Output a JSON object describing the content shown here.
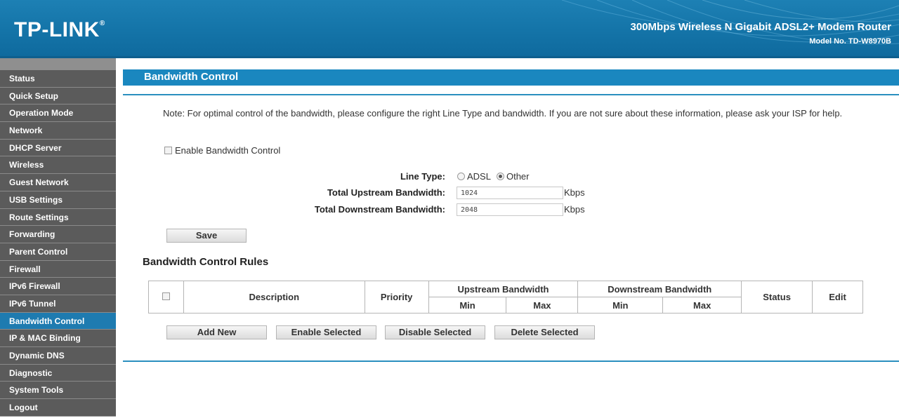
{
  "header": {
    "logo": "TP-LINK",
    "product": "300Mbps Wireless N Gigabit ADSL2+ Modem Router",
    "model": "Model No. TD-W8970B"
  },
  "sidebar": {
    "items": [
      {
        "label": "Status",
        "name": "status"
      },
      {
        "label": "Quick Setup",
        "name": "quick-setup"
      },
      {
        "label": "Operation Mode",
        "name": "operation-mode"
      },
      {
        "label": "Network",
        "name": "network"
      },
      {
        "label": "DHCP Server",
        "name": "dhcp-server"
      },
      {
        "label": "Wireless",
        "name": "wireless"
      },
      {
        "label": "Guest Network",
        "name": "guest-network"
      },
      {
        "label": "USB Settings",
        "name": "usb-settings"
      },
      {
        "label": "Route Settings",
        "name": "route-settings"
      },
      {
        "label": "Forwarding",
        "name": "forwarding"
      },
      {
        "label": "Parent Control",
        "name": "parent-control"
      },
      {
        "label": "Firewall",
        "name": "firewall"
      },
      {
        "label": "IPv6 Firewall",
        "name": "ipv6-firewall"
      },
      {
        "label": "IPv6 Tunnel",
        "name": "ipv6-tunnel"
      },
      {
        "label": "Bandwidth Control",
        "name": "bandwidth-control",
        "active": true
      },
      {
        "label": "IP & MAC Binding",
        "name": "ip-mac-binding"
      },
      {
        "label": "Dynamic DNS",
        "name": "dynamic-dns"
      },
      {
        "label": "Diagnostic",
        "name": "diagnostic"
      },
      {
        "label": "System Tools",
        "name": "system-tools"
      },
      {
        "label": "Logout",
        "name": "logout"
      }
    ]
  },
  "main": {
    "title": "Bandwidth Control",
    "note": "Note: For optimal control of the bandwidth, please configure the right Line Type and bandwidth. If you are not sure about these information, please ask your ISP for help.",
    "enable_label": "Enable Bandwidth Control",
    "line_type_label": "Line Type:",
    "line_type_options": {
      "adsl": "ADSL",
      "other": "Other"
    },
    "line_type_selected": "Other",
    "upstream_label": "Total Upstream Bandwidth:",
    "upstream_value": "1024",
    "downstream_label": "Total Downstream Bandwidth:",
    "downstream_value": "2048",
    "unit": "Kbps",
    "save_label": "Save",
    "rules_title": "Bandwidth Control Rules",
    "table": {
      "description": "Description",
      "priority": "Priority",
      "upstream": "Upstream Bandwidth",
      "downstream": "Downstream Bandwidth",
      "min": "Min",
      "max": "Max",
      "status": "Status",
      "edit": "Edit"
    },
    "actions": {
      "add_new": "Add New",
      "enable_selected": "Enable Selected",
      "disable_selected": "Disable Selected",
      "delete_selected": "Delete Selected"
    }
  }
}
